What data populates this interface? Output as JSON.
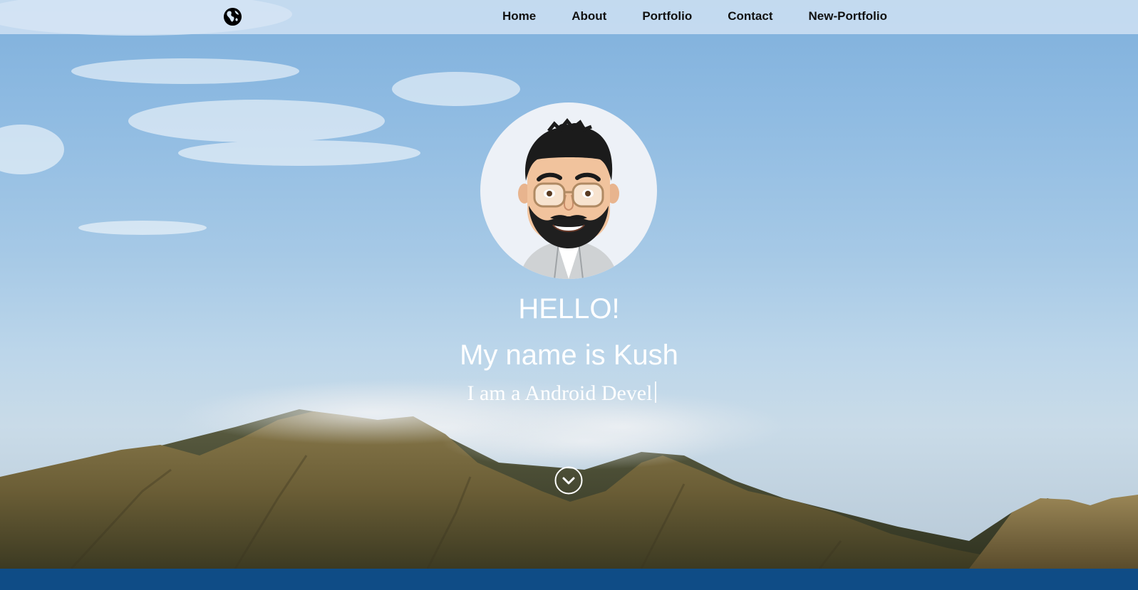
{
  "nav": {
    "logo_icon": "globe-icon",
    "links": [
      "Home",
      "About",
      "Portfolio",
      "Contact",
      "New-Portfolio"
    ]
  },
  "hero": {
    "avatar_icon": "avatar-illustration",
    "hello": "HELLO!",
    "name_line": "My name is Kush",
    "typed_line": "I am a Android Devel",
    "scroll_icon": "chevron-down-circle-icon"
  },
  "colors": {
    "footer": "#0f4c86",
    "text": "#ffffff",
    "nav_text": "#111111"
  }
}
